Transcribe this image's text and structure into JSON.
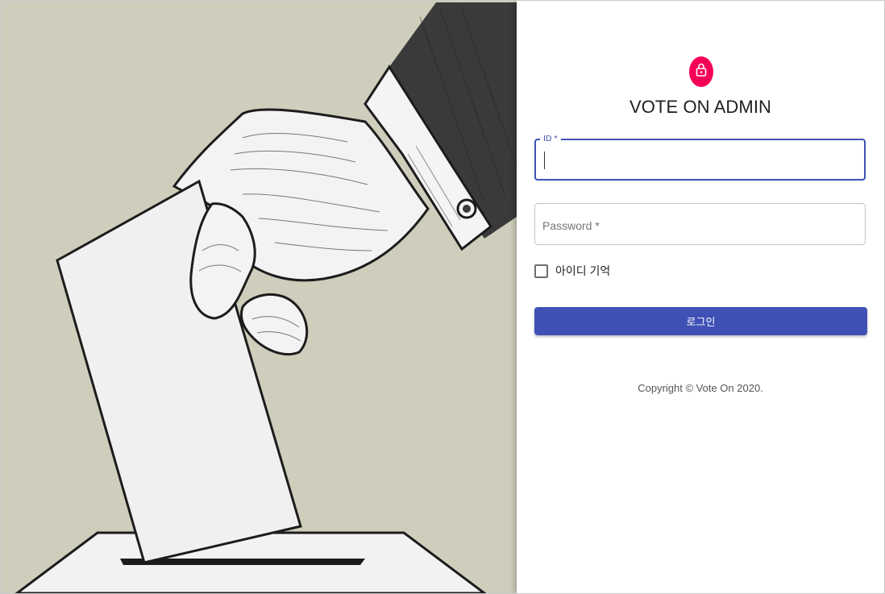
{
  "login": {
    "title": "VOTE ON ADMIN",
    "id_label": "ID *",
    "id_value": "",
    "password_label": "Password *",
    "password_value": "",
    "remember_label": "아이디 기억",
    "remember_checked": false,
    "submit_label": "로그인",
    "copyright": "Copyright © Vote On 2020.",
    "lock_icon": "lock-icon"
  },
  "colors": {
    "accent": "#3f51b5",
    "avatar": "#f50057",
    "hero_background": "#cfcdbb",
    "sleeve": "#3a3a3a"
  }
}
